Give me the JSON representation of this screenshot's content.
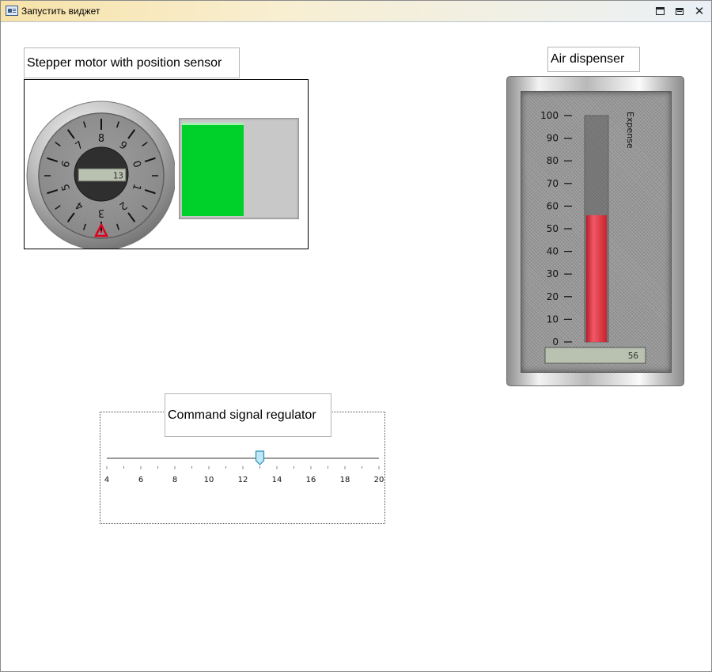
{
  "window": {
    "title": "Запустить виджет",
    "controls": [
      "maximize-icon",
      "restore-icon",
      "close-icon"
    ],
    "close_glyph": "✕"
  },
  "stepper_widget": {
    "label": "Stepper motor with position sensor",
    "dial_numbers": [
      "8",
      "9",
      "0",
      "1",
      "2",
      "3",
      "4",
      "5",
      "6",
      "7"
    ],
    "readout": "13",
    "warning_icon": "warning-triangle-icon",
    "bar_fill_fraction": 0.52,
    "bar_color": "#00d02a"
  },
  "air_widget": {
    "label": "Air dispenser",
    "axis_label": "Expense",
    "ticks": [
      "100",
      "90",
      "80",
      "70",
      "60",
      "50",
      "40",
      "30",
      "20",
      "10",
      "0"
    ],
    "value": 56,
    "value_text": "56",
    "fill_color": "#e53444"
  },
  "slider_widget": {
    "label": "Command signal regulator",
    "min": 4,
    "max": 20,
    "value": 13,
    "tick_labels": [
      "4",
      "6",
      "8",
      "10",
      "12",
      "14",
      "16",
      "18",
      "20"
    ]
  }
}
